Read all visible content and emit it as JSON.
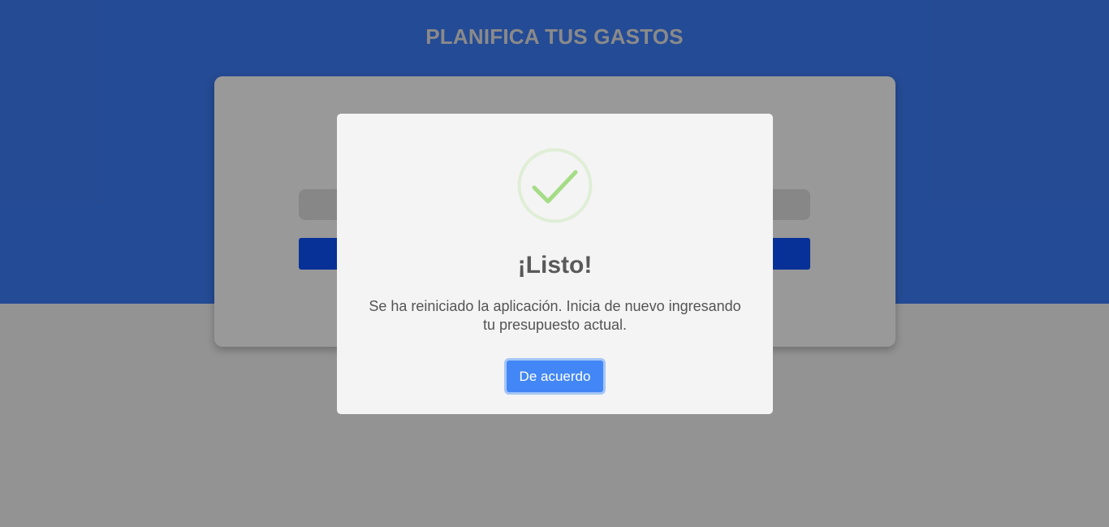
{
  "app": {
    "title": "PLANIFICA TUS GASTOS"
  },
  "form": {
    "budget_placeholder": "",
    "submit_label": ""
  },
  "modal": {
    "title": "¡Listo!",
    "message": "Se ha reiniciado la aplicación. Inicia de nuevo ingresando tu presupuesto actual.",
    "confirm_label": "De acuerdo",
    "icon": "success-check-icon"
  },
  "colors": {
    "header_blue": "#3d7df8",
    "button_blue": "#0d52fb",
    "confirm_blue": "#4287f5",
    "success_green": "#a5dc86",
    "title_gray": "#e6e6e6"
  }
}
